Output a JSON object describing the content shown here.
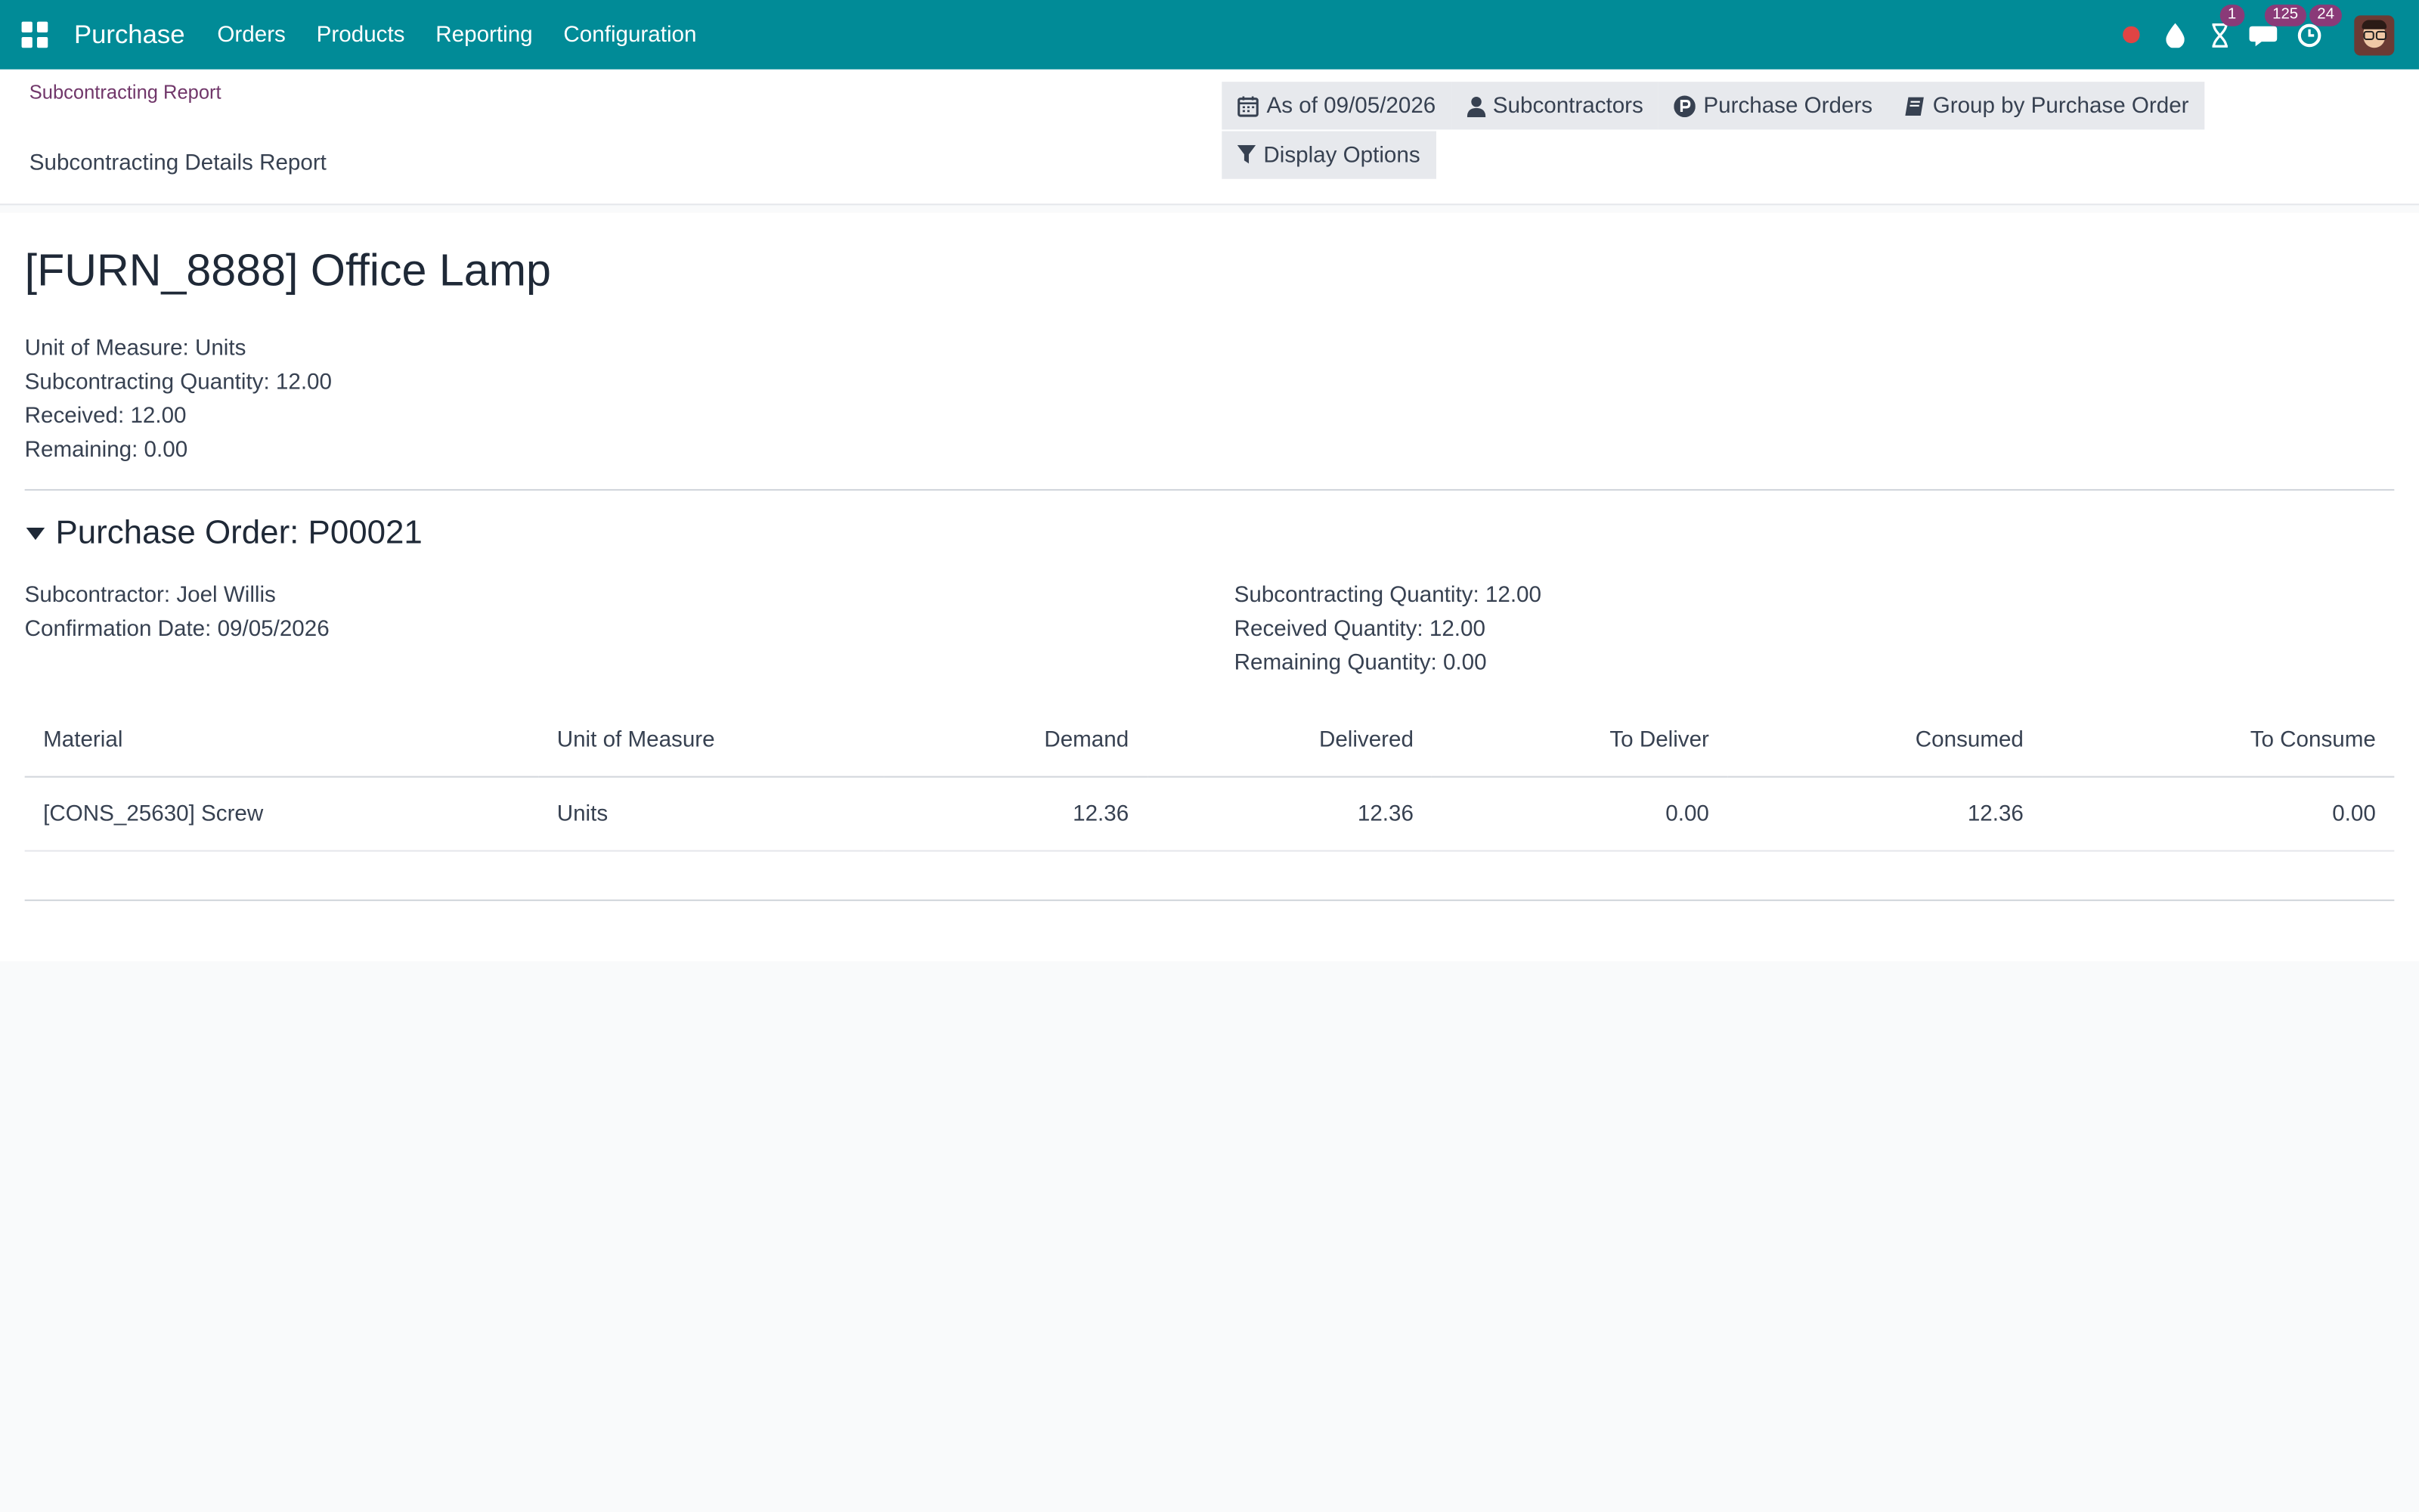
{
  "navbar": {
    "app_name": "Purchase",
    "menu": [
      {
        "label": "Orders"
      },
      {
        "label": "Products"
      },
      {
        "label": "Reporting"
      },
      {
        "label": "Configuration"
      }
    ],
    "badges": {
      "activities": "1",
      "messages": "125",
      "timer": "24"
    },
    "colors": {
      "navbar": "#018b97",
      "badge": "#8a3a78",
      "record": "#e04444"
    }
  },
  "control": {
    "breadcrumb": "Subcontracting Report",
    "subtitle": "Subcontracting Details Report",
    "filters": {
      "date": "As of 09/05/2026",
      "subcontractors": "Subcontractors",
      "purchase_orders": "Purchase Orders",
      "group_by": "Group by Purchase Order",
      "display_options": "Display Options"
    }
  },
  "report": {
    "product_title": "[FURN_8888] Office Lamp",
    "summary": {
      "uom": "Unit of Measure: Units",
      "subcontracting_qty": "Subcontracting Quantity: 12.00",
      "received": "Received: 12.00",
      "remaining": "Remaining: 0.00"
    },
    "purchase_order": {
      "title": "Purchase Order: P00021",
      "subcontractor": "Subcontractor: Joel Willis",
      "confirmation_date": "Confirmation Date: 09/05/2026",
      "subcontracting_qty": "Subcontracting Quantity: 12.00",
      "received_qty": "Received Quantity: 12.00",
      "remaining_qty": "Remaining Quantity: 0.00"
    },
    "table": {
      "headers": [
        "Material",
        "Unit of Measure",
        "Demand",
        "Delivered",
        "To Deliver",
        "Consumed",
        "To Consume"
      ],
      "rows": [
        [
          "[CONS_25630] Screw",
          "Units",
          "12.36",
          "12.36",
          "0.00",
          "12.36",
          "0.00"
        ]
      ]
    }
  }
}
